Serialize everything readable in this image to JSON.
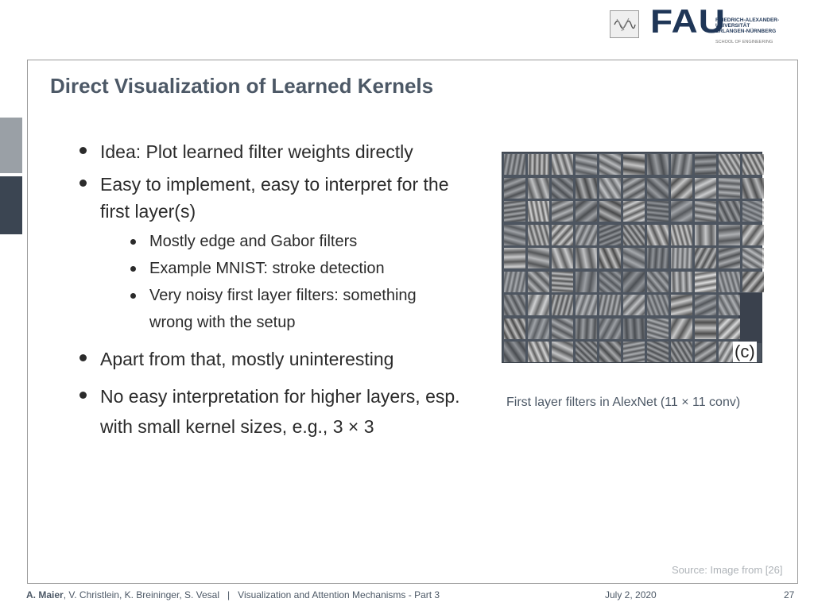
{
  "header": {
    "logo_word": "FAU",
    "logo_lines": [
      "FRIEDRICH-ALEXANDER-",
      "UNIVERSITÄT",
      "ERLANGEN-NÜRNBERG"
    ],
    "school": "SCHOOL OF ENGINEERING"
  },
  "slide": {
    "title": "Direct Visualization of Learned Kernels",
    "bullets": [
      {
        "text": "Idea: Plot learned filter weights directly"
      },
      {
        "text": "Easy to implement, easy to interpret for the",
        "cont": "first layer(s)"
      },
      {
        "text": "Mostly edge and Gabor filters"
      },
      {
        "text": "Example MNIST: stroke detection"
      },
      {
        "text": "Very noisy first layer filters: something",
        "cont": "wrong with the setup"
      },
      {
        "text": "Apart from that, mostly uninteresting"
      },
      {
        "text": "No easy interpretation for higher layers, esp.",
        "cont": "with small kernel sizes, e.g., 3 × 3"
      }
    ],
    "figure_label": "(c)",
    "caption": "First layer filters in AlexNet (11 × 11 conv)",
    "source": "Source: Image from [26]"
  },
  "footer": {
    "author_bold": "A. Maier",
    "authors_rest": ", V. Christlein, K. Breininger, S. Vesal",
    "separator": "|",
    "lecture": "Visualization and Attention Mechanisms - Part 3",
    "date": "July 2, 2020",
    "page": "27"
  },
  "colors": {
    "title": "#4c5866",
    "text": "#2b2b2b",
    "accent_dark": "#3b4552",
    "accent_light": "#9aa0a6",
    "logo": "#1f3657"
  }
}
